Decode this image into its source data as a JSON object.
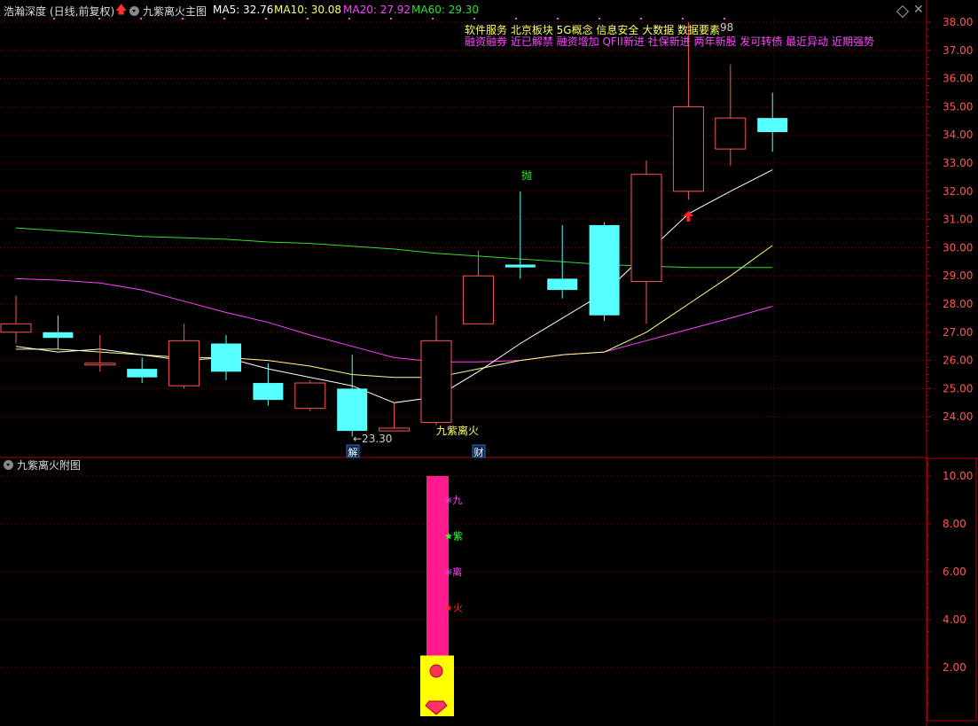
{
  "header": {
    "stock_name": "浩瀚深度",
    "period": "(日线,前复权)",
    "main_indicator": "九紫离火主图",
    "ma5": "MA5: 32.76",
    "ma10": "MA10: 30.08",
    "ma20": "MA20: 27.92",
    "ma60": "MA60: 29.30"
  },
  "tags": {
    "row1": "软件服务 北京板块 5G概念 信息安全 大数据 数据要素",
    "row2": "融资融券 近已解禁 融资增加 QFII新进 社保新进 两年新股 发可转债 最近异动 近期强势"
  },
  "sub_panel": {
    "title": "九紫离火附图",
    "labels": [
      "※九",
      "★紫",
      "※离",
      "★火"
    ]
  },
  "annotations": {
    "low_price": "←23.30",
    "high_price_suffix": "98",
    "signal_sell": "抛",
    "signal_name": "九紫离火",
    "marker_jie": "解",
    "marker_cai": "财"
  },
  "colors": {
    "up": "#ff5555",
    "down": "#55ffff",
    "ma5": "#ffffff",
    "ma10": "#ffff88",
    "ma20": "#ff44ff",
    "ma60": "#33dd33",
    "frame": "#b00000",
    "pink_bar": "#ff1b8d",
    "yellow_box": "#ffff00"
  },
  "chart_data": {
    "type": "candlestick",
    "y_axis_main": [
      "38.00",
      "37.00",
      "36.00",
      "35.00",
      "34.00",
      "33.00",
      "32.00",
      "31.00",
      "30.00",
      "29.00",
      "28.00",
      "27.00",
      "26.00",
      "25.00",
      "24.00"
    ],
    "y_axis_sub": [
      "10.00",
      "8.00",
      "6.00",
      "4.00",
      "2.00"
    ],
    "ylim_main": [
      23.2,
      38.2
    ],
    "ylim_sub": [
      0,
      10.4
    ],
    "candles": [
      {
        "o": 27.0,
        "c": 27.3,
        "h": 28.3,
        "l": 26.6
      },
      {
        "o": 27.0,
        "c": 26.8,
        "h": 27.6,
        "l": 26.4
      },
      {
        "o": 25.9,
        "c": 25.9,
        "h": 26.9,
        "l": 25.6
      },
      {
        "o": 25.7,
        "c": 25.4,
        "h": 26.1,
        "l": 25.2
      },
      {
        "o": 25.1,
        "c": 26.7,
        "h": 27.3,
        "l": 25.0
      },
      {
        "o": 26.6,
        "c": 25.6,
        "h": 26.9,
        "l": 25.3
      },
      {
        "o": 25.2,
        "c": 24.6,
        "h": 25.9,
        "l": 24.4
      },
      {
        "o": 24.3,
        "c": 25.2,
        "h": 25.3,
        "l": 24.2
      },
      {
        "o": 25.0,
        "c": 23.5,
        "h": 26.2,
        "l": 23.3
      },
      {
        "o": 23.5,
        "c": 23.6,
        "h": 24.5,
        "l": 23.5
      },
      {
        "o": 23.8,
        "c": 26.7,
        "h": 27.6,
        "l": 23.7
      },
      {
        "o": 27.3,
        "c": 29.0,
        "h": 29.9,
        "l": 27.3
      },
      {
        "o": 29.4,
        "c": 29.3,
        "h": 32.0,
        "l": 28.9
      },
      {
        "o": 28.9,
        "c": 28.5,
        "h": 30.8,
        "l": 28.2
      },
      {
        "o": 30.8,
        "c": 27.6,
        "h": 30.9,
        "l": 27.4
      },
      {
        "o": 28.8,
        "c": 32.6,
        "h": 33.1,
        "l": 27.3
      },
      {
        "o": 32.0,
        "c": 35.0,
        "h": 38.0,
        "l": 31.7
      },
      {
        "o": 33.5,
        "c": 34.6,
        "h": 36.5,
        "l": 32.9
      },
      {
        "o": 34.6,
        "c": 34.1,
        "h": 35.5,
        "l": 33.4
      }
    ],
    "ma5": [
      26.5,
      26.3,
      26.4,
      26.2,
      26.0,
      26.1,
      25.7,
      25.4,
      25.1,
      24.5,
      24.7,
      25.6,
      26.6,
      27.5,
      28.4,
      29.8,
      31.2,
      32.0,
      32.76
    ],
    "ma10": [
      26.4,
      26.4,
      26.3,
      26.2,
      26.1,
      26.1,
      26.0,
      25.8,
      25.5,
      25.4,
      25.4,
      25.7,
      26.0,
      26.2,
      26.3,
      27.0,
      28.0,
      29.0,
      30.08
    ],
    "ma20": [
      28.9,
      28.85,
      28.75,
      28.5,
      28.1,
      27.7,
      27.35,
      26.9,
      26.5,
      26.1,
      25.95,
      25.95,
      26.0,
      26.2,
      26.3,
      26.7,
      27.1,
      27.5,
      27.92
    ],
    "ma60": [
      30.7,
      30.6,
      30.5,
      30.4,
      30.35,
      30.3,
      30.2,
      30.15,
      30.05,
      29.95,
      29.8,
      29.7,
      29.6,
      29.5,
      29.4,
      29.35,
      29.3,
      29.3,
      29.3
    ]
  }
}
